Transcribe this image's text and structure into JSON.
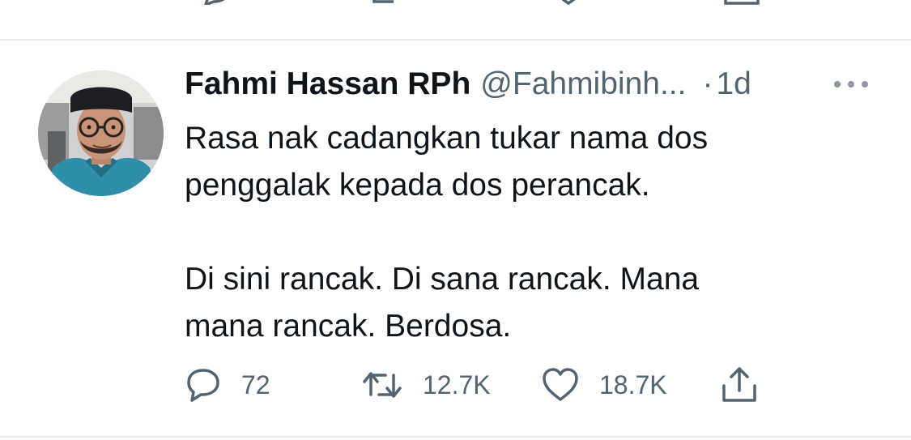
{
  "previous_tweet": {
    "action_icons": [
      "reply-icon",
      "retweet-icon",
      "like-icon",
      "share-icon"
    ]
  },
  "tweet": {
    "author": {
      "display_name": "Fahmi Hassan RPh",
      "handle": "@Fahmibinh...",
      "avatar": "profile-photo"
    },
    "separator": "·",
    "timestamp": "1d",
    "more_icon": "more-options-icon",
    "text": {
      "line1": "Rasa nak cadangkan tukar nama dos",
      "line2": "penggalak kepada dos perancak.",
      "line3": "Di sini rancak. Di sana rancak. Mana",
      "line4": "mana rancak. Berdosa."
    },
    "actions": {
      "reply": {
        "icon": "reply-icon",
        "count": "72"
      },
      "retweet": {
        "icon": "retweet-icon",
        "count": "12.7K"
      },
      "like": {
        "icon": "heart-icon",
        "count": "18.7K"
      },
      "share": {
        "icon": "share-icon"
      }
    }
  },
  "colors": {
    "text_primary": "#0f1419",
    "text_secondary": "#536471",
    "divider": "#e6ecf0",
    "background": "#ffffff"
  }
}
